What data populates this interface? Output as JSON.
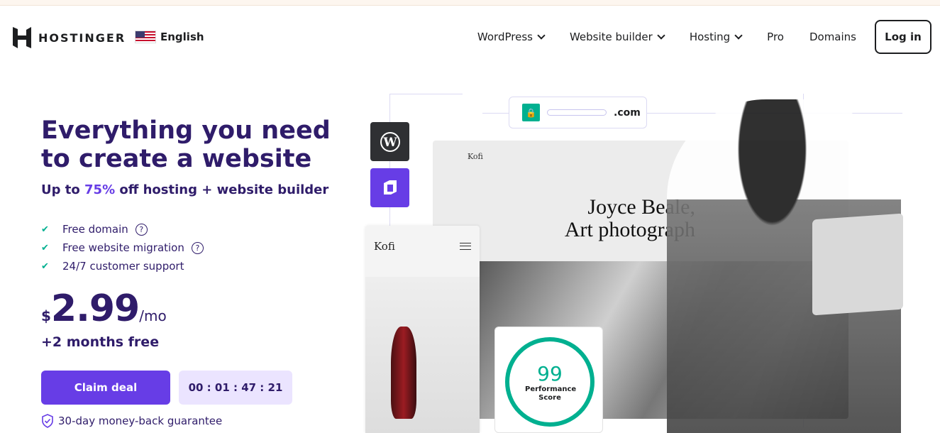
{
  "header": {
    "brand": "HOSTINGER",
    "language": "English",
    "nav": [
      {
        "label": "WordPress",
        "dropdown": true
      },
      {
        "label": "Website builder",
        "dropdown": true
      },
      {
        "label": "Hosting",
        "dropdown": true
      },
      {
        "label": "Pro",
        "dropdown": false
      },
      {
        "label": "Domains",
        "dropdown": false
      }
    ],
    "login": "Log in"
  },
  "hero": {
    "title": "Everything you need to create a website",
    "subtitle_pre": "Up to ",
    "subtitle_accent": "75%",
    "subtitle_post": " off hosting + website builder",
    "features": [
      "Free domain",
      "Free website migration",
      "24/7 customer support"
    ],
    "currency": "$",
    "price": "2.99",
    "period": "/mo",
    "bonus": "+2 months free",
    "cta": "Claim deal",
    "timer": "00 : 01 : 47 : 21",
    "guarantee": "30-day money-back guarantee"
  },
  "illustration": {
    "domain_suffix": ".com",
    "site_brand": "Kofi",
    "site_heading": "Joyce Beale, Art photograph",
    "mobile_brand": "Kofi",
    "score": "99",
    "score_label": "Performance Score"
  },
  "colors": {
    "accent": "#673de6",
    "dark": "#2f1c6a",
    "success": "#00b090"
  }
}
